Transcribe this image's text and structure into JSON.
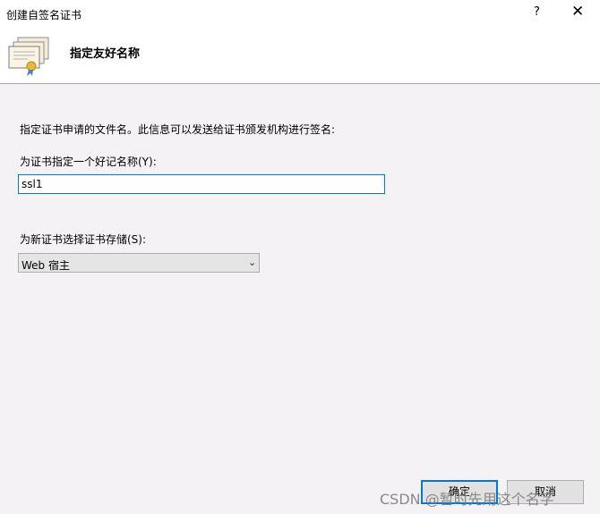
{
  "window": {
    "title": "创建自签名证书",
    "help_label": "?",
    "close_label": "✕"
  },
  "header": {
    "heading": "指定友好名称",
    "icon": "certificate-icon"
  },
  "form": {
    "description": "指定证书申请的文件名。此信息可以发送给证书颁发机构进行签名:",
    "name_label": "为证书指定一个好记名称(Y):",
    "name_value": "ssl1",
    "store_label": "为新证书选择证书存储(S):",
    "store_value": "Web 宿主"
  },
  "buttons": {
    "ok": "确定",
    "cancel": "取消"
  },
  "watermark": "CSDN @暂时先用这个名字",
  "colors": {
    "focus": "#0078d7",
    "background": "#f5f2f5"
  }
}
